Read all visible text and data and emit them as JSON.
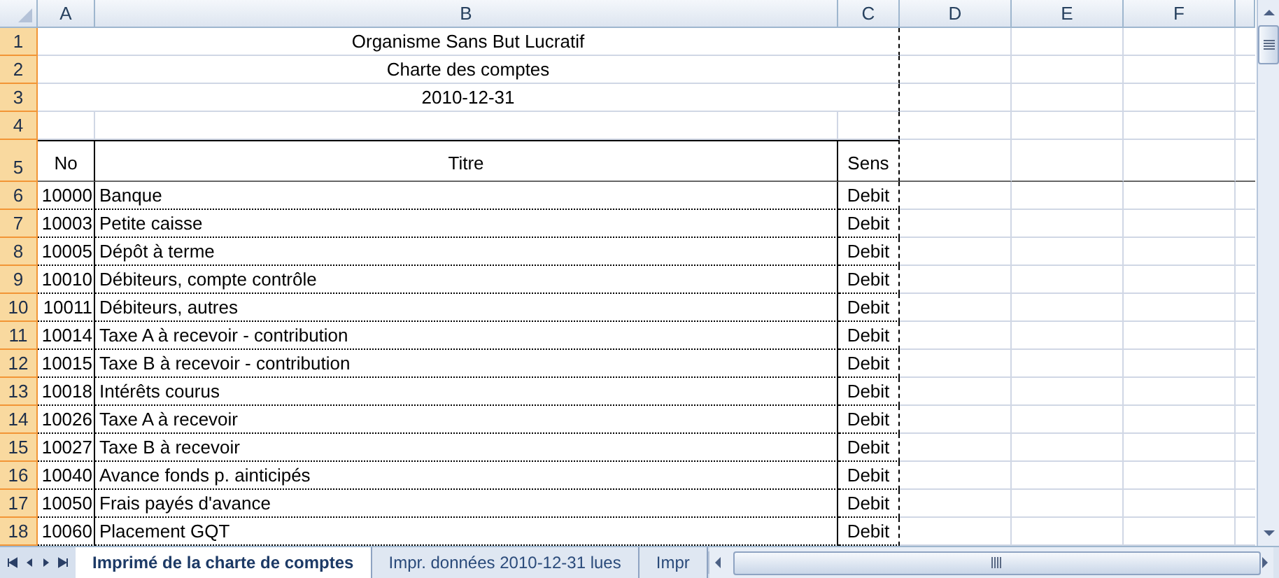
{
  "columns": [
    {
      "label": "A"
    },
    {
      "label": "B"
    },
    {
      "label": "C"
    },
    {
      "label": "D"
    },
    {
      "label": "E"
    },
    {
      "label": "F"
    }
  ],
  "row_headers": [
    {
      "label": "1",
      "highlighted": true
    },
    {
      "label": "2",
      "highlighted": true
    },
    {
      "label": "3",
      "highlighted": true
    },
    {
      "label": "4",
      "highlighted": true
    },
    {
      "label": "5",
      "highlighted": true
    },
    {
      "label": "6",
      "highlighted": true
    },
    {
      "label": "7",
      "highlighted": true
    },
    {
      "label": "8",
      "highlighted": true
    },
    {
      "label": "9",
      "highlighted": true
    },
    {
      "label": "10",
      "highlighted": true
    },
    {
      "label": "11",
      "highlighted": true
    },
    {
      "label": "12",
      "highlighted": true
    },
    {
      "label": "13",
      "highlighted": true
    },
    {
      "label": "14",
      "highlighted": true
    },
    {
      "label": "15",
      "highlighted": true
    },
    {
      "label": "16",
      "highlighted": true
    },
    {
      "label": "17",
      "highlighted": true
    },
    {
      "label": "18",
      "highlighted": true
    }
  ],
  "title_lines": [
    "Organisme Sans But Lucratif",
    "Charte des comptes",
    "2010-12-31"
  ],
  "table": {
    "headers": [
      "No",
      "Titre",
      "Sens"
    ],
    "rows": [
      {
        "no": "10000",
        "titre": "Banque",
        "sens": "Debit"
      },
      {
        "no": "10003",
        "titre": "Petite caisse",
        "sens": "Debit"
      },
      {
        "no": "10005",
        "titre": "Dépôt à terme",
        "sens": "Debit"
      },
      {
        "no": "10010",
        "titre": "Débiteurs, compte contrôle",
        "sens": "Debit"
      },
      {
        "no": "10011",
        "titre": "Débiteurs, autres",
        "sens": "Debit"
      },
      {
        "no": "10014",
        "titre": "Taxe A à recevoir - contribution",
        "sens": "Debit"
      },
      {
        "no": "10015",
        "titre": "Taxe B à recevoir - contribution",
        "sens": "Debit"
      },
      {
        "no": "10018",
        "titre": "Intérêts courus",
        "sens": "Debit"
      },
      {
        "no": "10026",
        "titre": "Taxe A à recevoir",
        "sens": "Debit"
      },
      {
        "no": "10027",
        "titre": "Taxe B à recevoir",
        "sens": "Debit"
      },
      {
        "no": "10040",
        "titre": "Avance fonds p. ainticipés",
        "sens": "Debit"
      },
      {
        "no": "10050",
        "titre": "Frais payés d'avance",
        "sens": "Debit"
      },
      {
        "no": "10060",
        "titre": "Placement GQT",
        "sens": "Debit"
      }
    ]
  },
  "sheet_tabs": [
    {
      "label": "Imprimé de la charte de comptes",
      "selected": true
    },
    {
      "label": "Impr. données 2010-12-31 lues",
      "selected": false
    },
    {
      "label": "Impr",
      "selected": false
    }
  ]
}
